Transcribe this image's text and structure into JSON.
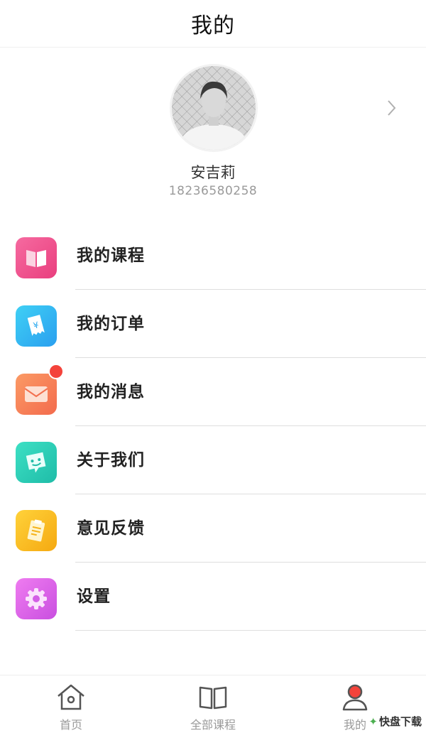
{
  "header": {
    "title": "我的"
  },
  "profile": {
    "name": "安吉莉",
    "phone": "18236580258"
  },
  "menu": {
    "items": [
      {
        "label": "我的课程",
        "icon": "book-icon",
        "color": "#ef4f8e"
      },
      {
        "label": "我的订单",
        "icon": "receipt-icon",
        "color": "#27b7ef"
      },
      {
        "label": "我的消息",
        "icon": "envelope-icon",
        "color": "#f77f55",
        "badge": true
      },
      {
        "label": "关于我们",
        "icon": "smiley-chat-icon",
        "color": "#22c9b5"
      },
      {
        "label": "意见反馈",
        "icon": "clipboard-icon",
        "color": "#f7bd1c"
      },
      {
        "label": "设置",
        "icon": "gear-icon",
        "color": "#d458e6"
      }
    ]
  },
  "tabbar": {
    "tabs": [
      {
        "label": "首页",
        "icon": "home-icon"
      },
      {
        "label": "全部课程",
        "icon": "book-outline-icon"
      },
      {
        "label": "我的",
        "icon": "user-icon",
        "active_color": "#f4433b"
      }
    ]
  },
  "watermark": {
    "text": "快盘下载"
  }
}
